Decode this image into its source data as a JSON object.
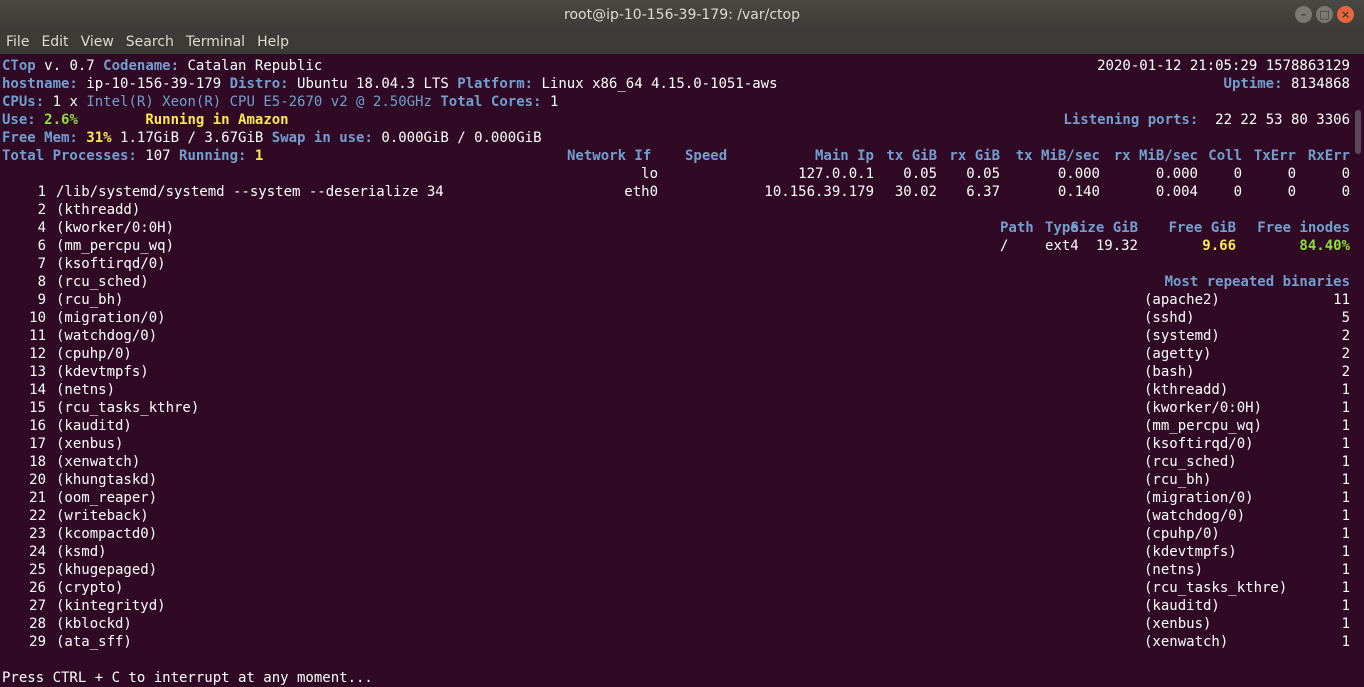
{
  "window": {
    "title": "root@ip-10-156-39-179: /var/ctop"
  },
  "menu": [
    "File",
    "Edit",
    "View",
    "Search",
    "Terminal",
    "Help"
  ],
  "header": {
    "app": "CTop",
    "version": "v. 0.7",
    "codename_label": "Codename:",
    "codename": "Catalan Republic",
    "datetime": "2020-01-12 21:05:29 1578863129",
    "hostname_label": "hostname:",
    "hostname": "ip-10-156-39-179",
    "distro_label": "Distro:",
    "distro": "Ubuntu 18.04.3 LTS",
    "platform_label": "Platform:",
    "platform": "Linux x86_64 4.15.0-1051-aws",
    "uptime_label": "Uptime:",
    "uptime": "8134868",
    "cpus_label": "CPUs:",
    "cpus": "1 x",
    "cpu_model": "Intel(R) Xeon(R) CPU E5-2670 v2 @ 2.50GHz",
    "cores_label": "Total Cores:",
    "cores": "1",
    "use_label": "Use:",
    "use": "2.6%",
    "running_in": "Running in Amazon",
    "ports_label": "Listening ports:",
    "ports": "22 22 53 80 3306",
    "freemem_label": "Free Mem:",
    "freemem_pct": "31%",
    "freemem": "1.17GiB / 3.67GiB",
    "swap_label": "Swap in use:",
    "swap": "0.000GiB / 0.000GiB",
    "procs_label": "Total Processes:",
    "procs": "107",
    "running_label": "Running:",
    "running": "1"
  },
  "network": {
    "headers": [
      "Network If",
      "Speed",
      "Main Ip",
      "tx GiB",
      "rx GiB",
      "tx MiB/sec",
      "rx MiB/sec",
      "Coll",
      "TxErr",
      "RxErr"
    ],
    "rows": [
      [
        "lo",
        "",
        "127.0.0.1",
        "0.05",
        "0.05",
        "0.000",
        "0.000",
        "0",
        "0",
        "0"
      ],
      [
        "eth0",
        "",
        "10.156.39.179",
        "30.02",
        "6.37",
        "0.140",
        "0.004",
        "0",
        "0",
        "0"
      ]
    ]
  },
  "disk": {
    "headers": [
      "Path",
      "Type",
      "Size GiB",
      "Free GiB",
      "Free inodes"
    ],
    "row": [
      "/",
      "ext4",
      "19.32",
      "9.66",
      "84.40%"
    ]
  },
  "processes": [
    {
      "pid": "1",
      "name": "/lib/systemd/systemd --system --deserialize 34"
    },
    {
      "pid": "2",
      "name": "(kthreadd)"
    },
    {
      "pid": "4",
      "name": "(kworker/0:0H)"
    },
    {
      "pid": "6",
      "name": "(mm_percpu_wq)"
    },
    {
      "pid": "7",
      "name": "(ksoftirqd/0)"
    },
    {
      "pid": "8",
      "name": "(rcu_sched)"
    },
    {
      "pid": "9",
      "name": "(rcu_bh)"
    },
    {
      "pid": "10",
      "name": "(migration/0)"
    },
    {
      "pid": "11",
      "name": "(watchdog/0)"
    },
    {
      "pid": "12",
      "name": "(cpuhp/0)"
    },
    {
      "pid": "13",
      "name": "(kdevtmpfs)"
    },
    {
      "pid": "14",
      "name": "(netns)"
    },
    {
      "pid": "15",
      "name": "(rcu_tasks_kthre)"
    },
    {
      "pid": "16",
      "name": "(kauditd)"
    },
    {
      "pid": "17",
      "name": "(xenbus)"
    },
    {
      "pid": "18",
      "name": "(xenwatch)"
    },
    {
      "pid": "20",
      "name": "(khungtaskd)"
    },
    {
      "pid": "21",
      "name": "(oom_reaper)"
    },
    {
      "pid": "22",
      "name": "(writeback)"
    },
    {
      "pid": "23",
      "name": "(kcompactd0)"
    },
    {
      "pid": "24",
      "name": "(ksmd)"
    },
    {
      "pid": "25",
      "name": "(khugepaged)"
    },
    {
      "pid": "26",
      "name": "(crypto)"
    },
    {
      "pid": "27",
      "name": "(kintegrityd)"
    },
    {
      "pid": "28",
      "name": "(kblockd)"
    },
    {
      "pid": "29",
      "name": "(ata_sff)"
    }
  ],
  "repeated": {
    "title": "Most repeated binaries",
    "items": [
      {
        "name": "(apache2)",
        "count": "11"
      },
      {
        "name": "(sshd)",
        "count": "5"
      },
      {
        "name": "(systemd)",
        "count": "2"
      },
      {
        "name": "(agetty)",
        "count": "2"
      },
      {
        "name": "(bash)",
        "count": "2"
      },
      {
        "name": "(kthreadd)",
        "count": "1"
      },
      {
        "name": "(kworker/0:0H)",
        "count": "1"
      },
      {
        "name": "(mm_percpu_wq)",
        "count": "1"
      },
      {
        "name": "(ksoftirqd/0)",
        "count": "1"
      },
      {
        "name": "(rcu_sched)",
        "count": "1"
      },
      {
        "name": "(rcu_bh)",
        "count": "1"
      },
      {
        "name": "(migration/0)",
        "count": "1"
      },
      {
        "name": "(watchdog/0)",
        "count": "1"
      },
      {
        "name": "(cpuhp/0)",
        "count": "1"
      },
      {
        "name": "(kdevtmpfs)",
        "count": "1"
      },
      {
        "name": "(netns)",
        "count": "1"
      },
      {
        "name": "(rcu_tasks_kthre)",
        "count": "1"
      },
      {
        "name": "(kauditd)",
        "count": "1"
      },
      {
        "name": "(xenbus)",
        "count": "1"
      },
      {
        "name": "(xenwatch)",
        "count": "1"
      }
    ]
  },
  "footer": "Press CTRL + C to interrupt at any moment..."
}
